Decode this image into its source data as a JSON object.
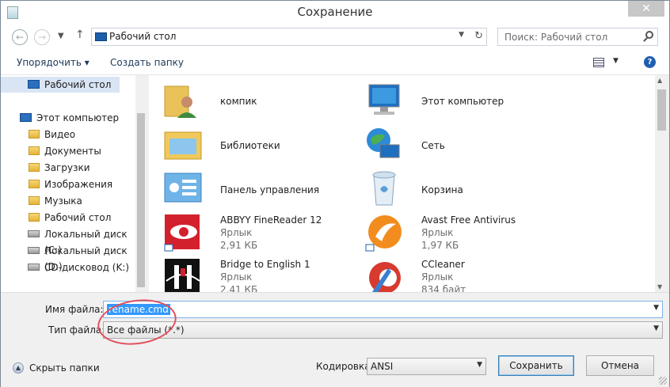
{
  "window": {
    "title": "Сохранение",
    "close_glyph": "✕"
  },
  "nav": {
    "back_glyph": "←",
    "forward_glyph": "→",
    "up_glyph": "↑",
    "address": "Рабочий стол",
    "search_placeholder": "Поиск: Рабочий стол"
  },
  "toolbar": {
    "organize": "Упорядочить ▾",
    "new_folder": "Создать папку",
    "help": "?"
  },
  "sidebar": {
    "items": [
      {
        "label": "Рабочий стол",
        "icon": "monitor-icon",
        "selected": true
      },
      {
        "label": "Этот компьютер",
        "icon": "computer-icon"
      },
      {
        "label": "Видео",
        "icon": "folder-icon"
      },
      {
        "label": "Документы",
        "icon": "folder-icon"
      },
      {
        "label": "Загрузки",
        "icon": "folder-icon"
      },
      {
        "label": "Изображения",
        "icon": "folder-icon"
      },
      {
        "label": "Музыка",
        "icon": "folder-icon"
      },
      {
        "label": "Рабочий стол",
        "icon": "folder-icon"
      },
      {
        "label": "Локальный диск (C:)",
        "icon": "drive-icon"
      },
      {
        "label": "Локальный диск (D:)",
        "icon": "drive-icon"
      },
      {
        "label": "CD-дисковод (K:)",
        "icon": "cd-drive-icon"
      }
    ]
  },
  "files": [
    {
      "name": "компик",
      "icon": "user-folder-icon"
    },
    {
      "name": "Этот компьютер",
      "icon": "computer-icon"
    },
    {
      "name": "Библиотеки",
      "icon": "libraries-icon"
    },
    {
      "name": "Сеть",
      "icon": "network-icon"
    },
    {
      "name": "Панель управления",
      "icon": "control-panel-icon"
    },
    {
      "name": "Корзина",
      "icon": "recycle-bin-icon"
    },
    {
      "name": "ABBYY FineReader 12",
      "type": "Ярлык",
      "size": "2,91 КБ",
      "icon": "finereader-icon"
    },
    {
      "name": "Avast Free Antivirus",
      "type": "Ярлык",
      "size": "1,97 КБ",
      "icon": "avast-icon"
    },
    {
      "name": "Bridge to English 1",
      "type": "Ярлык",
      "size": "2,41 КБ",
      "icon": "bridge-icon"
    },
    {
      "name": "CCleaner",
      "type": "Ярлык",
      "size": "834 байт",
      "icon": "ccleaner-icon"
    }
  ],
  "form": {
    "filename_label": "Имя файла:",
    "filename_value": "rename.cmd",
    "filetype_label": "Тип файла:",
    "filetype_value": "Все файлы  (*.*)",
    "encoding_label": "Кодировка:",
    "encoding_value": "ANSI",
    "hide_folders": "Скрыть папки",
    "save_button": "Сохранить",
    "cancel_button": "Отмена"
  },
  "colors": {
    "selection": "#3399ff",
    "highlight_ring": "#e0505e",
    "sidebar_selected": "#d9e5f5"
  }
}
